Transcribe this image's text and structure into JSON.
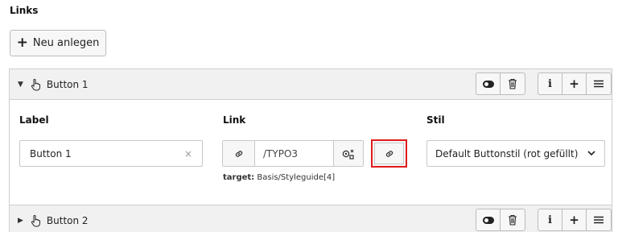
{
  "section_title": "Links",
  "new_button": {
    "plus": "+",
    "label": "Neu anlegen"
  },
  "items": [
    {
      "title": "Button 1",
      "expanded": true,
      "controls": {
        "info": "i",
        "add": "+"
      },
      "fields": {
        "label": {
          "title": "Label",
          "value": "Button 1",
          "clear": "×"
        },
        "link": {
          "title": "Link",
          "value": "/TYPO3",
          "target_label": "target:",
          "target_value": "Basis/Styleguide[4]"
        },
        "style": {
          "title": "Stil",
          "value": "Default Buttonstil (rot gefüllt)"
        }
      }
    },
    {
      "title": "Button 2",
      "expanded": false,
      "controls": {
        "info": "i",
        "add": "+"
      }
    }
  ],
  "highlight_color": "#e01b1b"
}
